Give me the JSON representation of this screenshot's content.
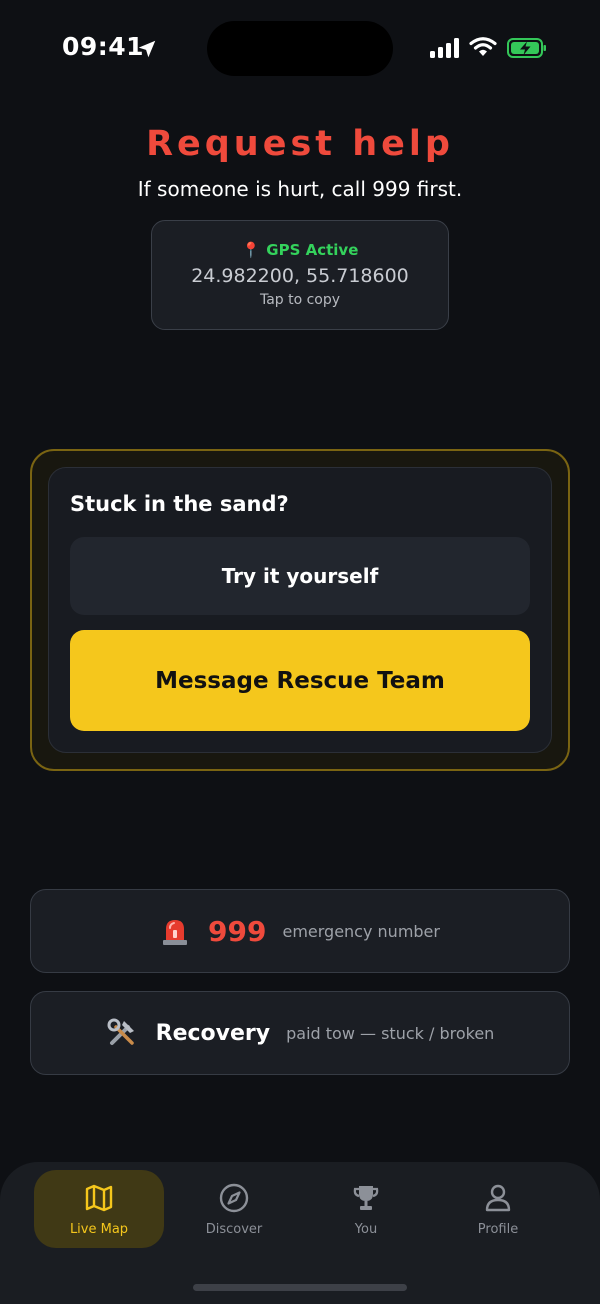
{
  "status_bar": {
    "time": "09:41",
    "icons": [
      "location-arrow-icon",
      "signal-icon",
      "wifi-icon",
      "battery-charging-icon"
    ]
  },
  "header": {
    "title": "Request help",
    "subtitle": "If someone is hurt, call 999 first."
  },
  "gps": {
    "status": "GPS Active",
    "coordinates": "24.982200, 55.718600",
    "hint": "Tap to copy",
    "icon": "pin-icon"
  },
  "stuck": {
    "title": "Stuck in the sand?",
    "try_label": "Try it yourself",
    "rescue_label": "Message Rescue Team"
  },
  "contacts": {
    "emergency": {
      "icon": "siren-icon",
      "number": "999",
      "description": "emergency number"
    },
    "recovery": {
      "icon": "tools-icon",
      "label": "Recovery",
      "description": "paid tow — stuck / broken"
    }
  },
  "tabs": [
    {
      "label": "Live Map",
      "icon": "map-icon",
      "active": true
    },
    {
      "label": "Discover",
      "icon": "compass-icon",
      "active": false
    },
    {
      "label": "You",
      "icon": "trophy-icon",
      "active": false
    },
    {
      "label": "Profile",
      "icon": "person-icon",
      "active": false
    }
  ],
  "colors": {
    "accent": "#f5c71c",
    "danger": "#ef4a3c",
    "gps_active": "#34d25c",
    "background": "#0e1014"
  }
}
